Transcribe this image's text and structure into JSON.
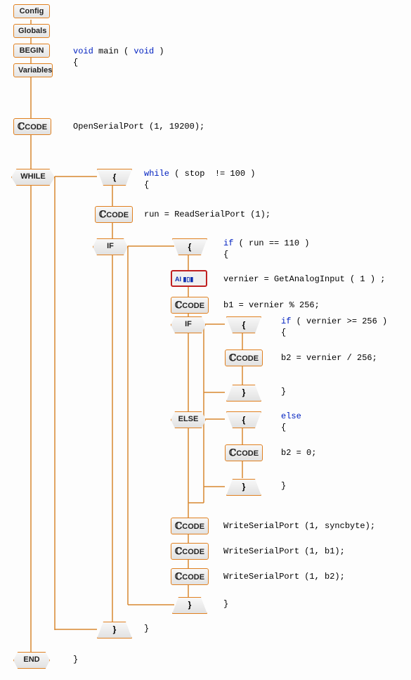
{
  "header": {
    "config": "Config",
    "globals": "Globals",
    "begin": "BEGIN",
    "variables": "Variables",
    "end": "END",
    "while_label": "WHILE",
    "if_label": "IF",
    "else_label": "ELSE",
    "ccode_label": "CODE",
    "open_brace": "{",
    "close_brace": "}"
  },
  "ai_block": "AI ▮▯▮",
  "code": {
    "main_sig": "void",
    "main_sig_mid": " main ( ",
    "main_sig_void2": "void",
    "main_sig_end": " )",
    "main_open": "{",
    "open_serial": "OpenSerialPort (1, 19200);",
    "while_kw": "while",
    "while_cond": " ( stop  != 100 )",
    "while_open": "{",
    "run_read": "run = ReadSerialPort (1);",
    "if_kw": "if",
    "if_cond": " ( run == 110 )",
    "if_open": "{",
    "vernier": "vernier = GetAnalogInput ( 1 ) ;",
    "b1": "b1 = vernier % 256;",
    "if2_kw": "if",
    "if2_cond": " ( vernier >= 256 )",
    "if2_open": "{",
    "b2div": "b2 = vernier / 256;",
    "if2_close": "}",
    "else_kw": "else",
    "else_open": "{",
    "b2zero": "b2 = 0;",
    "else_close": "}",
    "write1": "WriteSerialPort (1, syncbyte);",
    "write2": "WriteSerialPort (1, b1);",
    "write3": "WriteSerialPort (1, b2);",
    "if_close": "}",
    "while_close": "}",
    "main_close": "}"
  }
}
